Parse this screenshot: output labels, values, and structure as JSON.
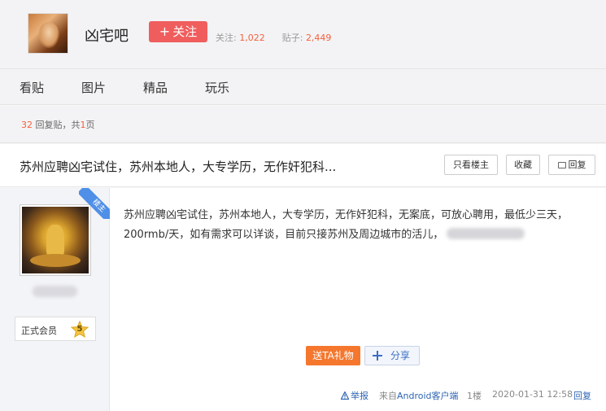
{
  "forum": {
    "name": "凶宅吧",
    "follow_label": "关注",
    "follow_plus": "+",
    "stats_follow_label": "关注:",
    "stats_follow_value": "1,022",
    "stats_posts_label": "贴子:",
    "stats_posts_value": "2,449"
  },
  "nav": {
    "items": [
      {
        "label": "看贴"
      },
      {
        "label": "图片"
      },
      {
        "label": "精品"
      },
      {
        "label": "玩乐"
      }
    ]
  },
  "summary": {
    "reply_count": "32",
    "reply_label": "回复贴，共",
    "page_count": "1",
    "page_label": "页"
  },
  "thread": {
    "title": "苏州应聘凶宅试住，苏州本地人，大专学历，无作奸犯科...",
    "buttons": {
      "only_op": "只看楼主",
      "favorite": "收藏",
      "reply": "回复"
    }
  },
  "post": {
    "ribbon": "楼主",
    "member_label": "正式会员",
    "member_level": "5",
    "content": "苏州应聘凶宅试住，苏州本地人，大专学历，无作奸犯科，无案底，可放心聘用，最低少三天，200rmb/天，如有需求可以详谈，目前只接苏州及周边城市的活儿，",
    "gift_label": "送TA礼物",
    "share_label": "分享",
    "footer": {
      "report": "举报",
      "source_prefix": "来自",
      "source_client": "Android客户端",
      "floor": "1楼",
      "datetime": "2020-01-31 12:58",
      "reply": "回复"
    }
  },
  "colors": {
    "accent_red": "#f05d5d",
    "accent_orange": "#f4603d",
    "link_blue": "#2d64b3",
    "ribbon_blue": "#4f8fe8"
  }
}
